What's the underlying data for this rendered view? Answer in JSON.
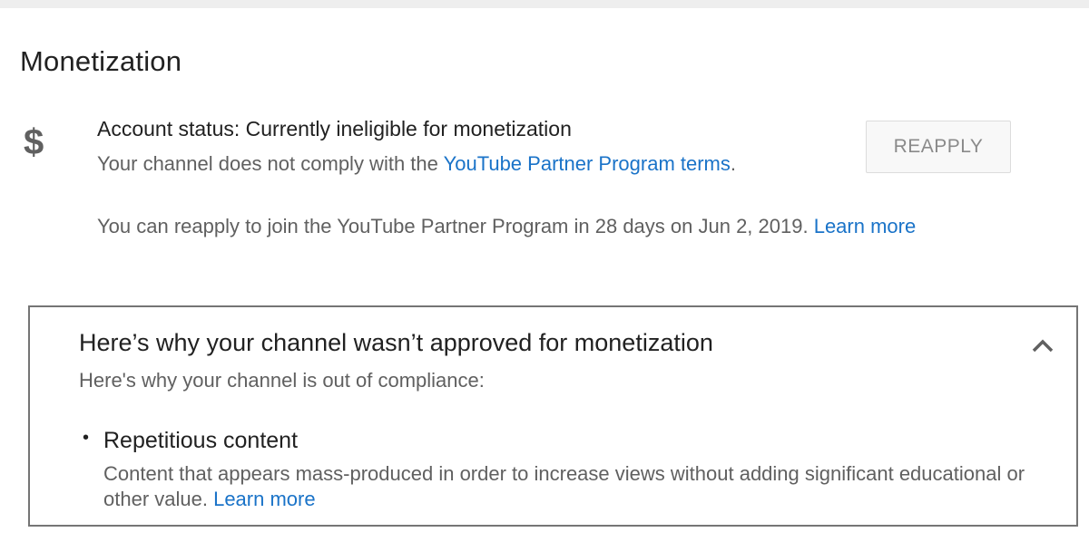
{
  "page": {
    "title": "Monetization"
  },
  "status": {
    "icon": "dollar-icon",
    "account_status": "Account status: Currently ineligible for monetization",
    "comply_prefix": "Your channel does not comply with the ",
    "comply_link": "YouTube Partner Program terms",
    "comply_suffix": ".",
    "reapply_button": "REAPPLY",
    "reapply_note": "You can reapply to join the YouTube Partner Program in 28 days on Jun 2, 2019. ",
    "reapply_learn_more": "Learn more"
  },
  "reasons": {
    "heading": "Here’s why your channel wasn’t approved for monetization",
    "subheading": "Here's why your channel is out of compliance:",
    "collapse_icon": "chevron-up-icon",
    "items": [
      {
        "bullet": "•",
        "title": "Repetitious content",
        "description": "Content that appears mass-produced in order to increase views without adding significant educational or other value.  ",
        "learn_more": "Learn more"
      }
    ]
  },
  "colors": {
    "link": "#1a73c8",
    "primary_text": "#212121",
    "secondary_text": "#606060",
    "panel_border": "#757575"
  }
}
